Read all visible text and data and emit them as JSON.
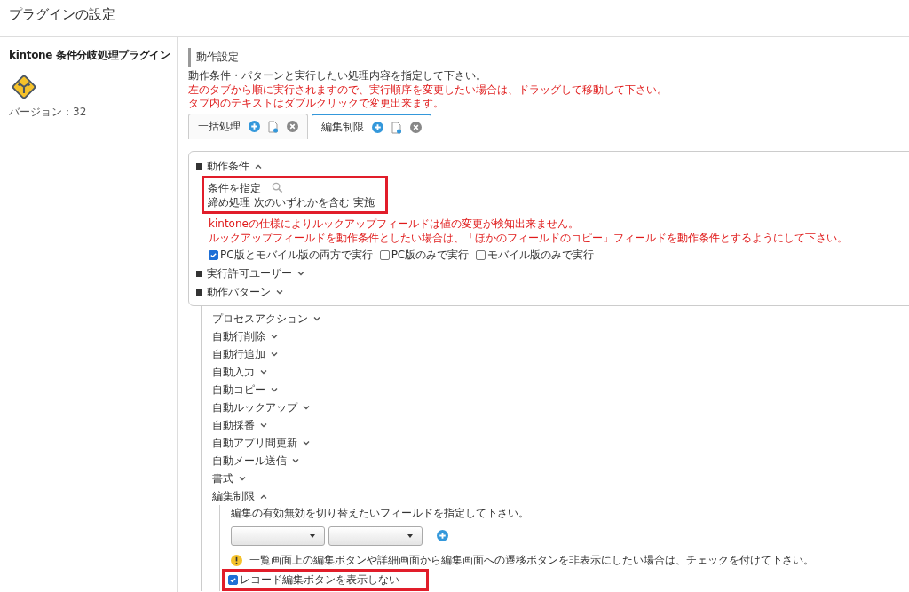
{
  "page_title": "プラグインの設定",
  "plugin": {
    "name": "kintone 条件分岐処理プラグイン",
    "version": "バージョン：32"
  },
  "settings": {
    "heading": "動作設定",
    "description": "動作条件・パターンと実行したい処理内容を指定して下さい。",
    "notes": [
      "左のタブから順に実行されますので、実行順序を変更したい場合は、ドラッグして移動して下さい。",
      "タブ内のテキストはダブルクリックで変更出来ます。"
    ]
  },
  "tabs": [
    {
      "label": "一括処理",
      "selected": false
    },
    {
      "label": "編集制限",
      "selected": true
    }
  ],
  "sections": [
    {
      "label": "動作条件",
      "expanded": true
    },
    {
      "label": "実行許可ユーザー",
      "expanded": false
    },
    {
      "label": "動作パターン",
      "expanded": false
    }
  ],
  "condition": {
    "label": "条件を指定",
    "summary": "締め処理 次のいずれかを含む 実施",
    "warnings": [
      "kintoneの仕様によりルックアップフィールドは値の変更が検知出来ません。",
      "ルックアップフィールドを動作条件としたい場合は、「ほかのフィールドのコピー」フィールドを動作条件とするようにして下さい。"
    ],
    "run_options": [
      {
        "label": "PC版とモバイル版の両方で実行",
        "checked": true
      },
      {
        "label": "PC版のみで実行",
        "checked": false
      },
      {
        "label": "モバイル版のみで実行",
        "checked": false
      }
    ]
  },
  "patterns": [
    {
      "label": "プロセスアクション",
      "expanded": false
    },
    {
      "label": "自動行削除",
      "expanded": false
    },
    {
      "label": "自動行追加",
      "expanded": false
    },
    {
      "label": "自動入力",
      "expanded": false
    },
    {
      "label": "自動コピー",
      "expanded": false
    },
    {
      "label": "自動ルックアップ",
      "expanded": false
    },
    {
      "label": "自動採番",
      "expanded": false
    },
    {
      "label": "自動アプリ間更新",
      "expanded": false
    },
    {
      "label": "自動メール送信",
      "expanded": false
    },
    {
      "label": "書式",
      "expanded": false
    },
    {
      "label": "編集制限",
      "expanded": true
    }
  ],
  "edit_limit": {
    "instruction": "編集の有効無効を切り替えたいフィールドを指定して下さい。",
    "warning": "一覧画面上の編集ボタンや詳細画面から編集画面への遷移ボタンを非表示にしたい場合は、チェックを付けて下さい。",
    "hide_button": {
      "label": "レコード編集ボタンを表示しない",
      "checked": true
    }
  }
}
